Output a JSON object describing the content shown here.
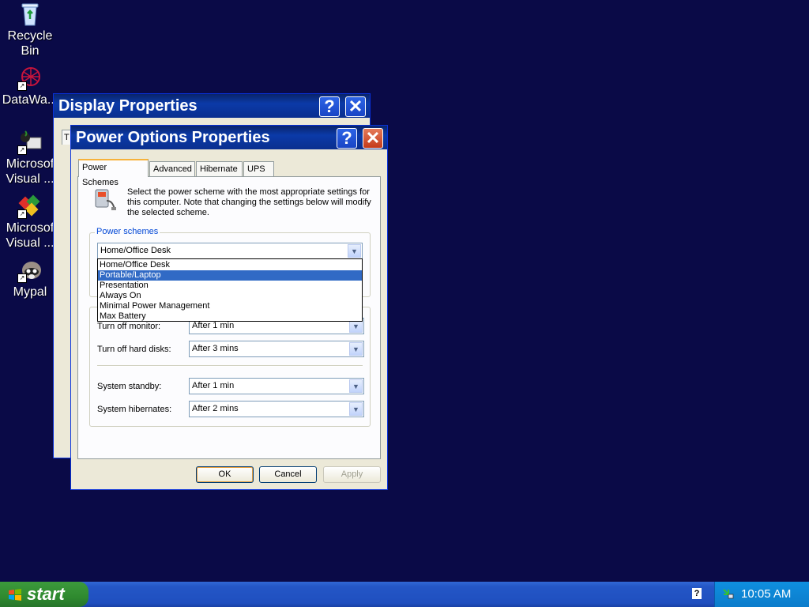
{
  "desktop": {
    "icons": [
      {
        "label": "Recycle\nBin",
        "icon": "recycle-bin-icon"
      },
      {
        "label": "DataWa...",
        "icon": "datawa-icon"
      },
      {
        "label": "Microsof\nVisual ...",
        "icon": "visual-studio-icon"
      },
      {
        "label": "Microsof\nVisual ...",
        "icon": "visual-studio-icon"
      },
      {
        "label": "Mypal",
        "icon": "mypal-icon"
      }
    ]
  },
  "display_properties": {
    "title": "Display Properties",
    "partial_tab": "T"
  },
  "power_options": {
    "title": "Power Options Properties",
    "tabs": [
      "Power Schemes",
      "Advanced",
      "Hibernate",
      "UPS"
    ],
    "description": "Select the power scheme with the most appropriate settings for this computer. Note that changing the settings below will modify the selected scheme.",
    "group_label": "Power schemes",
    "scheme_selected": "Home/Office Desk",
    "scheme_options": [
      "Home/Office Desk",
      "Portable/Laptop",
      "Presentation",
      "Always On",
      "Minimal Power Management",
      "Max Battery"
    ],
    "highlighted_option": "Portable/Laptop",
    "settings": [
      {
        "label": "Turn off monitor:",
        "value": "After 1 min"
      },
      {
        "label": "Turn off hard disks:",
        "value": "After 3 mins"
      },
      {
        "label": "System standby:",
        "value": "After 1 min"
      },
      {
        "label": "System hibernates:",
        "value": "After 2 mins"
      }
    ],
    "buttons": {
      "ok": "OK",
      "cancel": "Cancel",
      "apply": "Apply"
    }
  },
  "taskbar": {
    "start_label": "start",
    "clock": "10:05 AM",
    "help_glyph": "?"
  },
  "colors": {
    "desktop": "#0a0a47",
    "titlebar": "#0b3aa8",
    "selection": "#316ac5",
    "start_green": "#2f8a2f"
  }
}
